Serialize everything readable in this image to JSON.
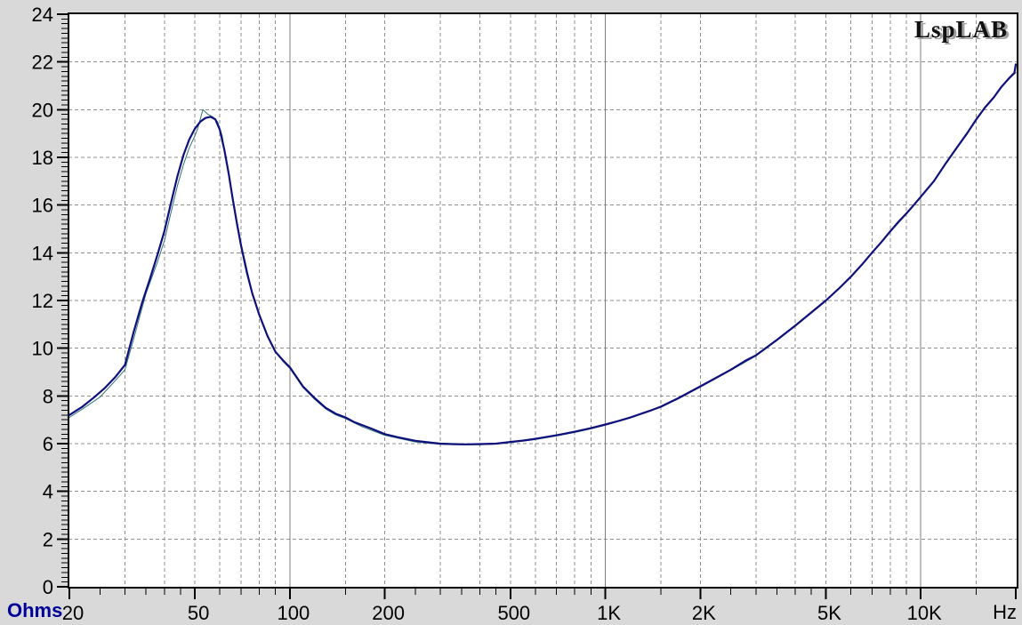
{
  "chart_data": {
    "type": "line",
    "title": "",
    "watermark": "LspLAB",
    "grid": "on",
    "legend": "none",
    "colors": {
      "background": "#d9d9d9",
      "plot_background": "#ffffff",
      "border": "#000000",
      "grid_dashed": "#8f8f8f",
      "grid_solid": "#7d7d7d",
      "tick": "#000000",
      "label": "#000000",
      "y_unit_label": "#000099"
    },
    "x_axis": {
      "scale": "log",
      "unit": "Hz",
      "range_hz": [
        20,
        20000
      ],
      "major_ticks": [
        {
          "hz": 20,
          "label": "20"
        },
        {
          "hz": 50,
          "label": "50"
        },
        {
          "hz": 100,
          "label": "100"
        },
        {
          "hz": 200,
          "label": "200"
        },
        {
          "hz": 500,
          "label": "500"
        },
        {
          "hz": 1000,
          "label": "1K"
        },
        {
          "hz": 2000,
          "label": "2K"
        },
        {
          "hz": 5000,
          "label": "5K"
        },
        {
          "hz": 10000,
          "label": "10K"
        },
        {
          "hz": 20000,
          "label": ""
        }
      ],
      "minor_ticks_hz": [
        25,
        30,
        35,
        40,
        45,
        60,
        70,
        80,
        90,
        150,
        250,
        300,
        350,
        400,
        450,
        600,
        700,
        800,
        900,
        1500,
        2500,
        3000,
        3500,
        4000,
        4500,
        6000,
        7000,
        8000,
        9000,
        15000
      ],
      "solid_gridlines_hz": [
        100,
        1000,
        10000
      ],
      "dashed_gridlines_hz": [
        30,
        40,
        50,
        60,
        70,
        80,
        90,
        150,
        200,
        300,
        400,
        500,
        600,
        700,
        800,
        900,
        1500,
        2000,
        3000,
        4000,
        5000,
        6000,
        7000,
        8000,
        9000,
        15000
      ]
    },
    "y_axis": {
      "scale": "linear",
      "unit": "Ohms",
      "range_ohms": [
        0,
        24
      ],
      "major_tick_step": 2,
      "minor_tick_step": 0.2,
      "major_tick_labels": [
        "0",
        "2",
        "4",
        "6",
        "8",
        "10",
        "12",
        "14",
        "16",
        "18",
        "20",
        "22",
        "24"
      ]
    },
    "series": [
      {
        "name": "impedance-curve-overlay-thin",
        "color": "#2e7474",
        "stroke_width": 1,
        "points": [
          [
            20,
            7.1
          ],
          [
            22,
            7.45
          ],
          [
            25,
            7.95
          ],
          [
            28,
            8.65
          ],
          [
            30,
            9.1
          ],
          [
            32,
            10.4
          ],
          [
            35,
            12.3
          ],
          [
            38,
            13.6
          ],
          [
            40,
            14.5
          ],
          [
            42,
            15.7
          ],
          [
            44,
            16.8
          ],
          [
            46,
            17.7
          ],
          [
            48,
            18.4
          ],
          [
            50,
            18.9
          ],
          [
            51,
            19.2
          ],
          [
            53,
            20.0
          ],
          [
            55,
            19.8
          ],
          [
            57,
            19.7
          ],
          [
            59,
            19.5
          ],
          [
            61,
            18.9
          ],
          [
            64,
            17.3
          ],
          [
            66,
            16.3
          ],
          [
            68,
            15.3
          ],
          [
            70,
            14.4
          ],
          [
            72,
            13.7
          ],
          [
            76,
            12.3
          ],
          [
            80,
            11.4
          ],
          [
            85,
            10.5
          ],
          [
            90,
            9.85
          ],
          [
            95,
            9.45
          ],
          [
            100,
            9.15
          ],
          [
            110,
            8.35
          ],
          [
            120,
            7.85
          ],
          [
            130,
            7.45
          ],
          [
            140,
            7.2
          ],
          [
            150,
            7.05
          ],
          [
            170,
            6.7
          ],
          [
            200,
            6.35
          ],
          [
            250,
            6.07
          ],
          [
            300,
            5.97
          ],
          [
            350,
            5.95
          ],
          [
            400,
            5.95
          ],
          [
            450,
            5.98
          ],
          [
            500,
            6.04
          ],
          [
            600,
            6.17
          ],
          [
            700,
            6.32
          ],
          [
            800,
            6.47
          ],
          [
            900,
            6.62
          ],
          [
            1000,
            6.77
          ],
          [
            1200,
            7.07
          ],
          [
            1500,
            7.52
          ],
          [
            1700,
            7.87
          ],
          [
            2000,
            8.37
          ],
          [
            2500,
            9.07
          ],
          [
            3000,
            9.67
          ],
          [
            3500,
            10.32
          ],
          [
            4000,
            10.92
          ],
          [
            4500,
            11.47
          ],
          [
            5000,
            11.97
          ],
          [
            6000,
            12.97
          ],
          [
            7000,
            13.97
          ],
          [
            8000,
            14.87
          ],
          [
            9000,
            15.62
          ],
          [
            10000,
            16.32
          ],
          [
            11000,
            16.97
          ],
          [
            12000,
            17.72
          ],
          [
            13000,
            18.37
          ],
          [
            14000,
            18.97
          ],
          [
            15000,
            19.57
          ],
          [
            16000,
            20.07
          ],
          [
            17000,
            20.47
          ],
          [
            18000,
            20.92
          ],
          [
            19000,
            21.27
          ],
          [
            20000,
            21.55
          ]
        ]
      },
      {
        "name": "impedance-curve-main",
        "color": "#10107c",
        "stroke_width": 2.2,
        "points": [
          [
            20,
            7.2
          ],
          [
            22,
            7.55
          ],
          [
            24,
            7.95
          ],
          [
            26,
            8.35
          ],
          [
            28,
            8.8
          ],
          [
            30,
            9.3
          ],
          [
            32,
            10.7
          ],
          [
            34,
            11.9
          ],
          [
            36,
            12.9
          ],
          [
            38,
            13.9
          ],
          [
            40,
            14.9
          ],
          [
            42,
            16.1
          ],
          [
            44,
            17.2
          ],
          [
            46,
            18.1
          ],
          [
            48,
            18.75
          ],
          [
            50,
            19.2
          ],
          [
            52,
            19.5
          ],
          [
            54,
            19.65
          ],
          [
            56,
            19.7
          ],
          [
            58,
            19.6
          ],
          [
            60,
            19.15
          ],
          [
            62,
            18.3
          ],
          [
            64,
            17.3
          ],
          [
            66,
            16.2
          ],
          [
            68,
            15.2
          ],
          [
            70,
            14.3
          ],
          [
            73,
            13.2
          ],
          [
            76,
            12.3
          ],
          [
            80,
            11.4
          ],
          [
            85,
            10.5
          ],
          [
            90,
            9.85
          ],
          [
            95,
            9.5
          ],
          [
            100,
            9.2
          ],
          [
            110,
            8.4
          ],
          [
            120,
            7.9
          ],
          [
            130,
            7.5
          ],
          [
            140,
            7.25
          ],
          [
            150,
            7.1
          ],
          [
            160,
            6.9
          ],
          [
            180,
            6.65
          ],
          [
            200,
            6.4
          ],
          [
            220,
            6.27
          ],
          [
            250,
            6.12
          ],
          [
            280,
            6.04
          ],
          [
            300,
            6.0
          ],
          [
            330,
            5.98
          ],
          [
            360,
            5.97
          ],
          [
            400,
            5.98
          ],
          [
            450,
            6.0
          ],
          [
            500,
            6.07
          ],
          [
            550,
            6.13
          ],
          [
            600,
            6.2
          ],
          [
            700,
            6.35
          ],
          [
            800,
            6.5
          ],
          [
            900,
            6.65
          ],
          [
            1000,
            6.8
          ],
          [
            1100,
            6.95
          ],
          [
            1200,
            7.1
          ],
          [
            1400,
            7.4
          ],
          [
            1500,
            7.55
          ],
          [
            1700,
            7.9
          ],
          [
            2000,
            8.4
          ],
          [
            2200,
            8.7
          ],
          [
            2500,
            9.1
          ],
          [
            2800,
            9.5
          ],
          [
            3000,
            9.7
          ],
          [
            3500,
            10.35
          ],
          [
            4000,
            10.95
          ],
          [
            4500,
            11.5
          ],
          [
            5000,
            12.0
          ],
          [
            5500,
            12.5
          ],
          [
            6000,
            13.0
          ],
          [
            6500,
            13.5
          ],
          [
            7000,
            14.0
          ],
          [
            7500,
            14.45
          ],
          [
            8000,
            14.9
          ],
          [
            8500,
            15.3
          ],
          [
            9000,
            15.65
          ],
          [
            9500,
            16.0
          ],
          [
            10000,
            16.35
          ],
          [
            11000,
            17.0
          ],
          [
            12000,
            17.75
          ],
          [
            13000,
            18.4
          ],
          [
            14000,
            19.0
          ],
          [
            15000,
            19.6
          ],
          [
            16000,
            20.1
          ],
          [
            17000,
            20.5
          ],
          [
            18000,
            20.95
          ],
          [
            19000,
            21.3
          ],
          [
            19800,
            21.55
          ],
          [
            20000,
            21.9
          ]
        ]
      }
    ]
  }
}
